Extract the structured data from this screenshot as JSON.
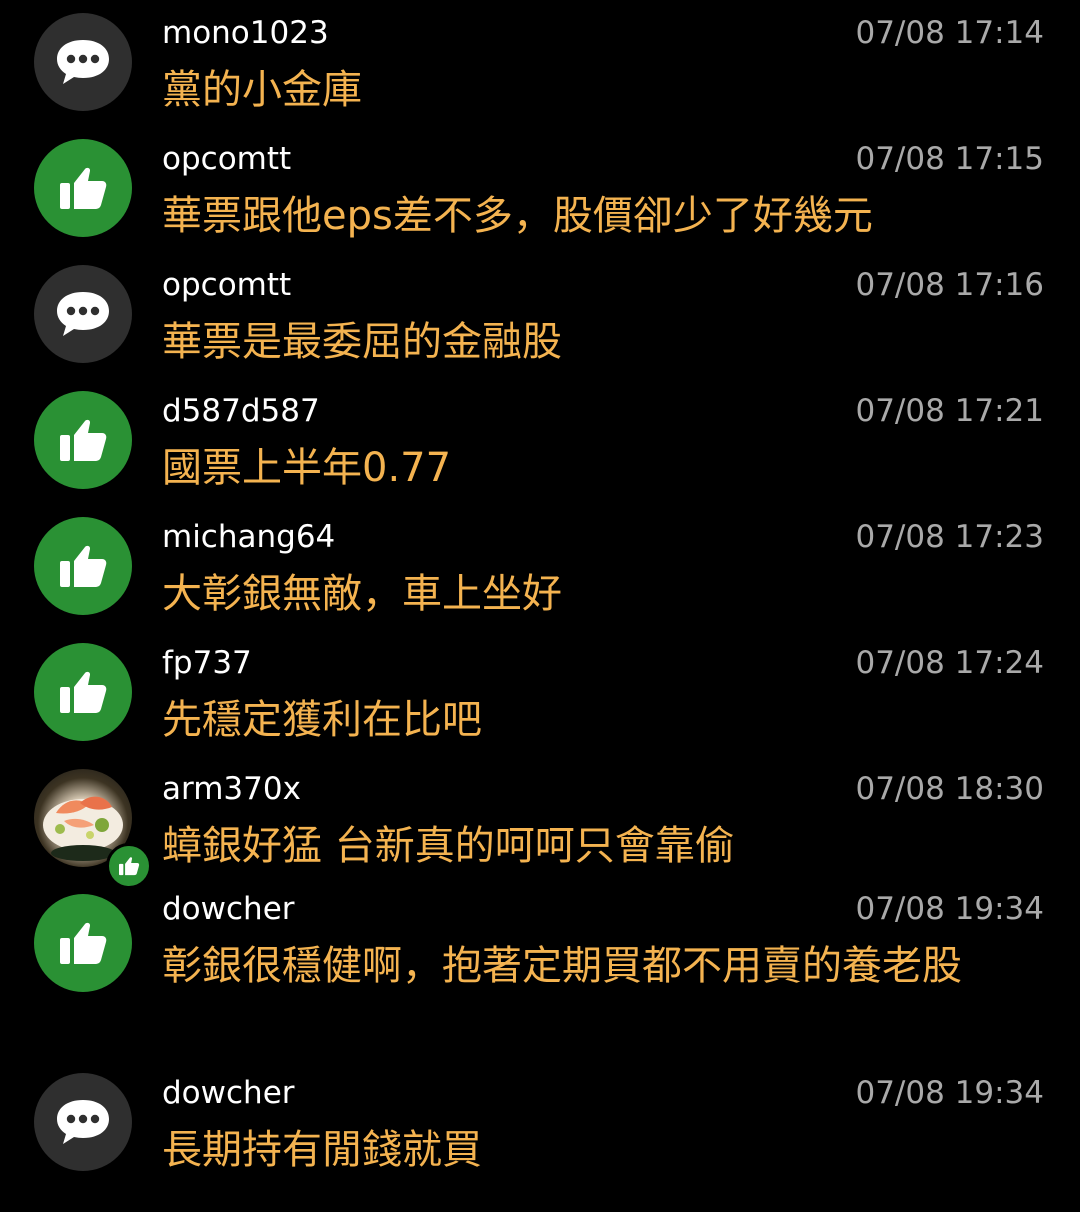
{
  "comments": [
    {
      "user": "mono1023",
      "time": "07/08 17:14",
      "text": "黨的小金庫",
      "avatar": "chat-bubble-icon"
    },
    {
      "user": "opcomtt",
      "time": "07/08 17:15",
      "text": "華票跟他eps差不多，股價卻少了好幾元",
      "avatar": "thumbs-up-icon"
    },
    {
      "user": "opcomtt",
      "time": "07/08 17:16",
      "text": "華票是最委屈的金融股",
      "avatar": "chat-bubble-icon"
    },
    {
      "user": "d587d587",
      "time": "07/08 17:21",
      "text": "國票上半年0.77",
      "avatar": "thumbs-up-icon"
    },
    {
      "user": "michang64",
      "time": "07/08 17:23",
      "text": "大彰銀無敵，車上坐好",
      "avatar": "thumbs-up-icon"
    },
    {
      "user": "fp737",
      "time": "07/08 17:24",
      "text": "先穩定獲利在比吧",
      "avatar": "thumbs-up-icon"
    },
    {
      "user": "arm370x",
      "time": "07/08 18:30",
      "text": "蟑銀好猛 台新真的呵呵只會靠偷",
      "avatar": "user-photo"
    },
    {
      "user": "dowcher",
      "time": "07/08 19:34",
      "text": "彰銀很穩健啊，抱著定期買都不用賣的養老股",
      "avatar": "thumbs-up-icon"
    },
    {
      "user": "dowcher",
      "time": "07/08 19:34",
      "text": "長期持有閒錢就買",
      "avatar": "chat-bubble-icon"
    }
  ],
  "colors": {
    "background": "#000000",
    "username": "#ffffff",
    "timestamp": "#a9a9a9",
    "message": "#f4b350",
    "like_green": "#2a9134",
    "chat_gray": "#2f2f2f"
  }
}
